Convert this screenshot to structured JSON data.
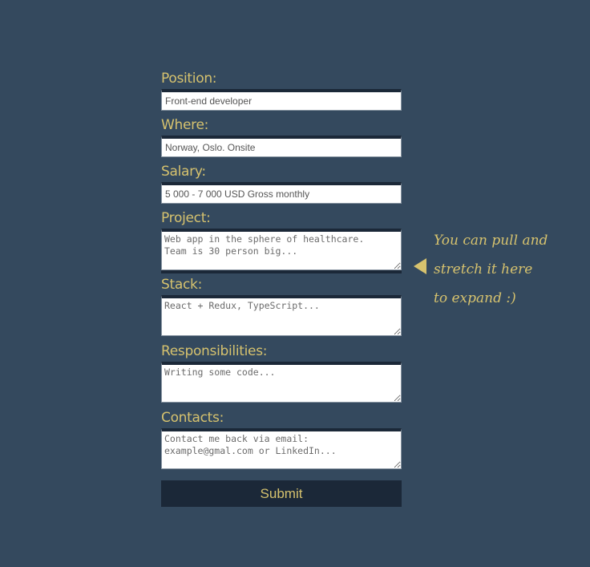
{
  "form": {
    "position": {
      "label": "Position:",
      "placeholder": "Front-end developer"
    },
    "where": {
      "label": "Where:",
      "placeholder": "Norway, Oslo. Onsite"
    },
    "salary": {
      "label": "Salary:",
      "placeholder": "5 000 - 7 000 USD Gross monthly"
    },
    "project": {
      "label": "Project:",
      "placeholder": "Web app in the sphere of healthcare.\nTeam is 30 person big..."
    },
    "stack": {
      "label": "Stack:",
      "placeholder": "React + Redux, TypeScript..."
    },
    "responsibilities": {
      "label": "Responsibilities:",
      "placeholder": "Writing some code..."
    },
    "contacts": {
      "label": "Contacts:",
      "placeholder": "Contact me back via email:\nexample@gmal.com or LinkedIn..."
    },
    "submit_label": "Submit"
  },
  "hint": {
    "lines": [
      "You can pull and",
      "stretch it here",
      "to expand :)"
    ],
    "icon": "arrow-left-icon"
  },
  "colors": {
    "background": "#34495e",
    "accent": "#d6c26e",
    "dark": "#1b2838"
  }
}
